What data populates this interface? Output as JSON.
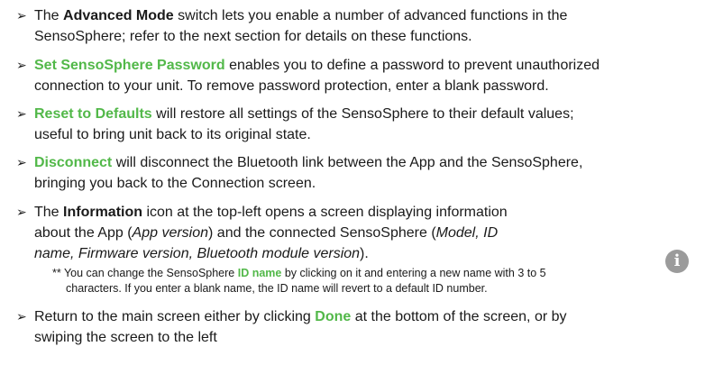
{
  "bullet_glyph": "➢",
  "items": [
    {
      "line1_a": "The ",
      "line1_b": "Advanced Mode",
      "line1_c": " switch lets you enable a number of advanced functions in the",
      "line2": "SensoSphere; refer to the next section for details on these functions."
    },
    {
      "line1_b": "Set SensoSphere Password",
      "line1_c": " enables you to define a password to prevent unauthorized",
      "line2": "connection to your unit. To remove password protection, enter a blank password."
    },
    {
      "line1_b": "Reset to Defaults",
      "line1_c": " will restore all settings of the SensoSphere to their default values;",
      "line2": "useful to bring unit back to its original state."
    },
    {
      "line1_b": "Disconnect",
      "line1_c": " will disconnect the Bluetooth link between the App and the SensoSphere,",
      "line2": "bringing you back to the Connection screen."
    },
    {
      "line1_a": "The ",
      "line1_b": "Information",
      "line1_c": " icon at the top-left opens a screen displaying information",
      "line2_a": "about the App (",
      "line2_b": "App version",
      "line2_c": ") and the connected SensoSphere (",
      "line2_d": "Model, ID",
      "line3_a": "name, Firmware version, Bluetooth module version",
      "line3_b": ")."
    },
    {
      "line1_a": "Return to the main screen either by clicking ",
      "line1_b": "Done",
      "line1_c": " at the bottom of the screen, or by",
      "line2": "swiping the screen to the left"
    }
  ],
  "note": {
    "a": "** You can change the SensoSphere ",
    "b": "ID name",
    "c": " by clicking on it and entering a new name with 3 to 5",
    "d": "characters. If you enter a blank name, the ID name will revert to a default ID number."
  },
  "icons": {
    "info": "info-icon",
    "info_glyph": "i"
  },
  "colors": {
    "accent_green": "#52b849",
    "icon_gray": "#9b9b9b",
    "text": "#1a1a1a"
  }
}
